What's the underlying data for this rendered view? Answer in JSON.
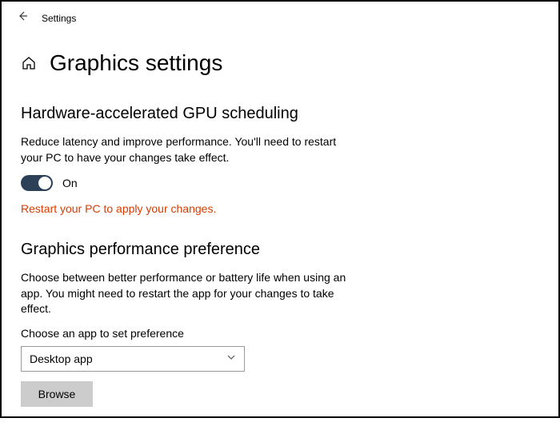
{
  "header": {
    "label": "Settings"
  },
  "page": {
    "title": "Graphics settings"
  },
  "gpu_section": {
    "heading": "Hardware-accelerated GPU scheduling",
    "description": "Reduce latency and improve performance. You'll need to restart your PC to have your changes take effect.",
    "toggle_state": "On",
    "warning": "Restart your PC to apply your changes."
  },
  "perf_section": {
    "heading": "Graphics performance preference",
    "description": "Choose between better performance or battery life when using an app. You might need to restart the app for your changes to take effect.",
    "field_label": "Choose an app to set preference",
    "dropdown_value": "Desktop app",
    "browse_label": "Browse"
  }
}
